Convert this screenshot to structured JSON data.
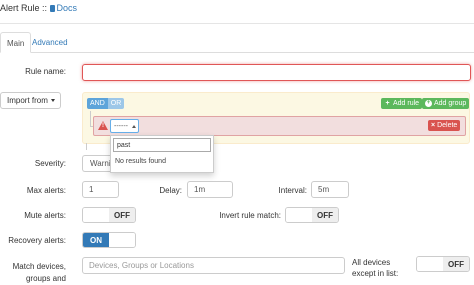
{
  "header": {
    "title": "Alert Rule ::",
    "docs_link": "Docs"
  },
  "tabs": [
    {
      "label": "Main",
      "active": true
    },
    {
      "label": "Advanced",
      "active": false
    }
  ],
  "form": {
    "rule_name": {
      "label": "Rule name:",
      "value": ""
    },
    "import_from": {
      "label": "Import from"
    },
    "builder": {
      "and_label": "AND",
      "or_label": "OR",
      "add_rule_label": "Add rule",
      "add_group_label": "Add group",
      "delete_label": "Delete",
      "filter_value": "------",
      "dropdown": {
        "search_value": "past",
        "no_results": "No results found"
      }
    },
    "severity": {
      "label": "Severity:",
      "value": "Warni"
    },
    "max_alerts": {
      "label": "Max alerts:",
      "value": "1"
    },
    "delay": {
      "label": "Delay:",
      "value": "1m"
    },
    "interval": {
      "label": "Interval:",
      "value": "5m"
    },
    "mute_alerts": {
      "label": "Mute alerts:",
      "state": "OFF"
    },
    "invert_rule_match": {
      "label": "Invert rule match:",
      "state": "OFF"
    },
    "recovery_alerts": {
      "label": "Recovery alerts:",
      "state": "ON"
    },
    "match_devices": {
      "label_line1": "Match devices,",
      "label_line2": "groups and",
      "placeholder": "Devices, Groups or Locations"
    },
    "all_devices_except": {
      "label_line1": "All devices",
      "label_line2": "except in list:",
      "state": "OFF"
    }
  },
  "colors": {
    "primary": "#337ab7",
    "success": "#5cb85c",
    "danger": "#d9534f",
    "builder_bg": "#fcf8e3",
    "error_row_bg": "#f2dede"
  }
}
